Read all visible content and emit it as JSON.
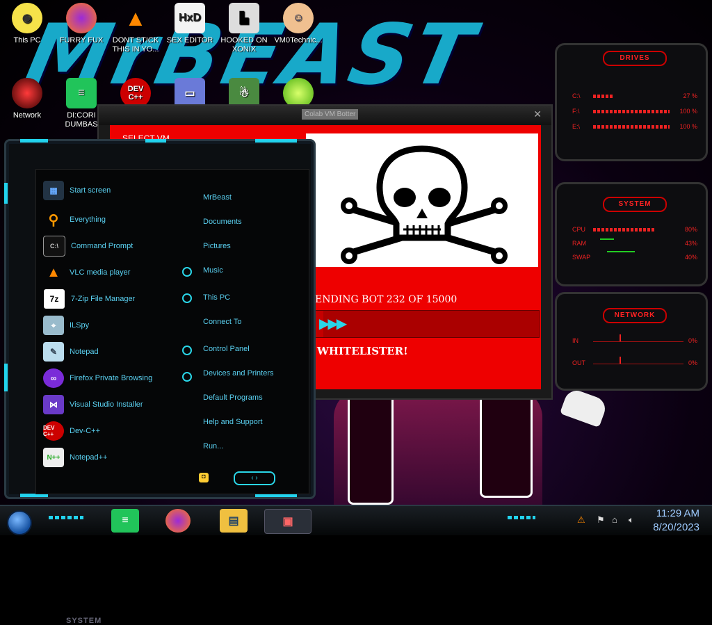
{
  "desktop_icons": [
    {
      "label": "This PC",
      "icon": "this-pc-icon"
    },
    {
      "label": "FURRY FUX",
      "icon": "firefox-icon"
    },
    {
      "label": "DONT STICK THIS IN YO...",
      "icon": "vlc-icon"
    },
    {
      "label": "SEX EDITOR",
      "icon": "hxd-icon"
    },
    {
      "label": "HOOKED ON XONIX",
      "icon": "xonix-icon"
    },
    {
      "label": "VM0Technic...",
      "icon": "doctor-icon"
    },
    {
      "label": "Network",
      "icon": "network-icon"
    },
    {
      "label": "DI:CORI DUMBAS",
      "icon": "discord-icon"
    },
    {
      "label": "",
      "icon": "devcpp-icon"
    },
    {
      "label": "",
      "icon": "card-icon"
    },
    {
      "label": "",
      "icon": "santa-icon"
    },
    {
      "label": "",
      "icon": "lime-icon"
    }
  ],
  "vm_window": {
    "title": "Colab VM Botter",
    "select_vm": "SELECT VM",
    "sending_text": "ENDING BOT 232 OF 15000",
    "progress_fraction": 0.05,
    "whitelister": "WHITELISTER!"
  },
  "start_menu": {
    "left_items": [
      {
        "label": "Start screen",
        "icon": "start-screen-icon"
      },
      {
        "label": "Everything",
        "icon": "search-icon"
      },
      {
        "label": "Command Prompt",
        "icon": "cmd-icon"
      },
      {
        "label": "VLC media player",
        "icon": "vlc-icon"
      },
      {
        "label": "7-Zip File Manager",
        "icon": "7zip-icon"
      },
      {
        "label": "ILSpy",
        "icon": "ilspy-icon"
      },
      {
        "label": "Notepad",
        "icon": "notepad-icon"
      },
      {
        "label": "Firefox Private Browsing",
        "icon": "private-browsing-icon"
      },
      {
        "label": "Visual Studio Installer",
        "icon": "vs-installer-icon"
      },
      {
        "label": "Dev-C++",
        "icon": "devcpp-icon"
      },
      {
        "label": "Notepad++",
        "icon": "notepadpp-icon"
      }
    ],
    "right_items": [
      {
        "label": "MrBeast",
        "arrow": false
      },
      {
        "label": "Documents",
        "arrow": false
      },
      {
        "label": "Pictures",
        "arrow": false
      },
      {
        "label": "Music",
        "arrow": true
      },
      {
        "label": "This PC",
        "arrow": true
      },
      {
        "label": "Connect To",
        "arrow": false
      },
      {
        "label": "Control Panel",
        "arrow": true
      },
      {
        "label": "Devices and Printers",
        "arrow": true
      },
      {
        "label": "Default Programs",
        "arrow": false
      },
      {
        "label": "Help and Support",
        "arrow": false
      },
      {
        "label": "Run...",
        "arrow": false
      }
    ],
    "system_label": "SYSTEM"
  },
  "gadgets": {
    "drives": {
      "title": "DRIVES",
      "rows": [
        {
          "label": "C:\\",
          "value": "27 %",
          "fraction": 0.27
        },
        {
          "label": "F:\\",
          "value": "100 %",
          "fraction": 1.0
        },
        {
          "label": "E:\\",
          "value": "100 %",
          "fraction": 1.0
        }
      ]
    },
    "system": {
      "title": "SYSTEM",
      "rows": [
        {
          "label": "CPU",
          "value": "80%"
        },
        {
          "label": "RAM",
          "value": "43%"
        },
        {
          "label": "SWAP",
          "value": "40%"
        }
      ]
    },
    "network": {
      "title": "NETWORK",
      "rows": [
        {
          "label": "IN",
          "value": "0%"
        },
        {
          "label": "OUT",
          "value": "0%"
        }
      ]
    }
  },
  "taskbar": {
    "clock_time": "11:29 AM",
    "clock_date": "8/20/2023"
  },
  "colors": {
    "accent_cyan": "#22d3ee",
    "vm_red": "#ee0000",
    "gadget_red": "#e22222",
    "menu_text": "#5ad0f0"
  }
}
